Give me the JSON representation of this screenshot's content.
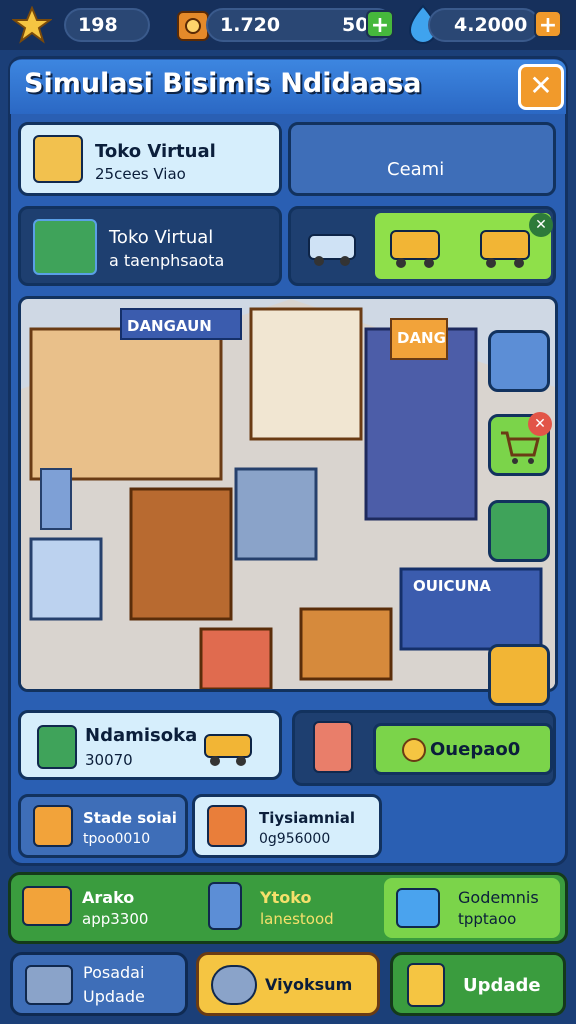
{
  "topbar": {
    "stars": "198",
    "coins": "1.720",
    "cash": "50,",
    "gems": "4.2000",
    "plus_label": "+"
  },
  "panel": {
    "title": "Simulasi Bisimis Ndidaasa",
    "close_label": "✕"
  },
  "cards": {
    "toko1_title": "Toko Virtual",
    "toko1_sub": "25cees Viao",
    "ceami": "Ceami",
    "toko2_title": "Toko Virtual",
    "toko2_sub": "a taenphsaota"
  },
  "scene_signs": {
    "sign1": "DANGAUN",
    "sign2": "DANG",
    "sign3": "OUICUNA"
  },
  "lower": {
    "nd_title": "Ndamisoka",
    "nd_value": "30070",
    "opa_button": "Ouepao0",
    "stade_title": "Stade soiai",
    "stade_value": "tpoo0010",
    "tips_title": "Tiysiamnial",
    "tips_value": "0g956000"
  },
  "strip": {
    "arako_title": "Arako",
    "arako_sub": "app3300",
    "ytoko_title": "Ytoko",
    "ytoko_sub": "lanestood",
    "gode_title": "Godemnis",
    "gode_sub": "tpptaoo"
  },
  "bottom": {
    "posadai_line1": "Posadai",
    "posadai_line2": "Updade",
    "viyo_label": "Viyoksum",
    "update_label": "Updade"
  },
  "colors": {
    "accent_orange": "#f19a2b",
    "accent_green": "#8fe04a",
    "panel_blue": "#2a5fb3"
  }
}
